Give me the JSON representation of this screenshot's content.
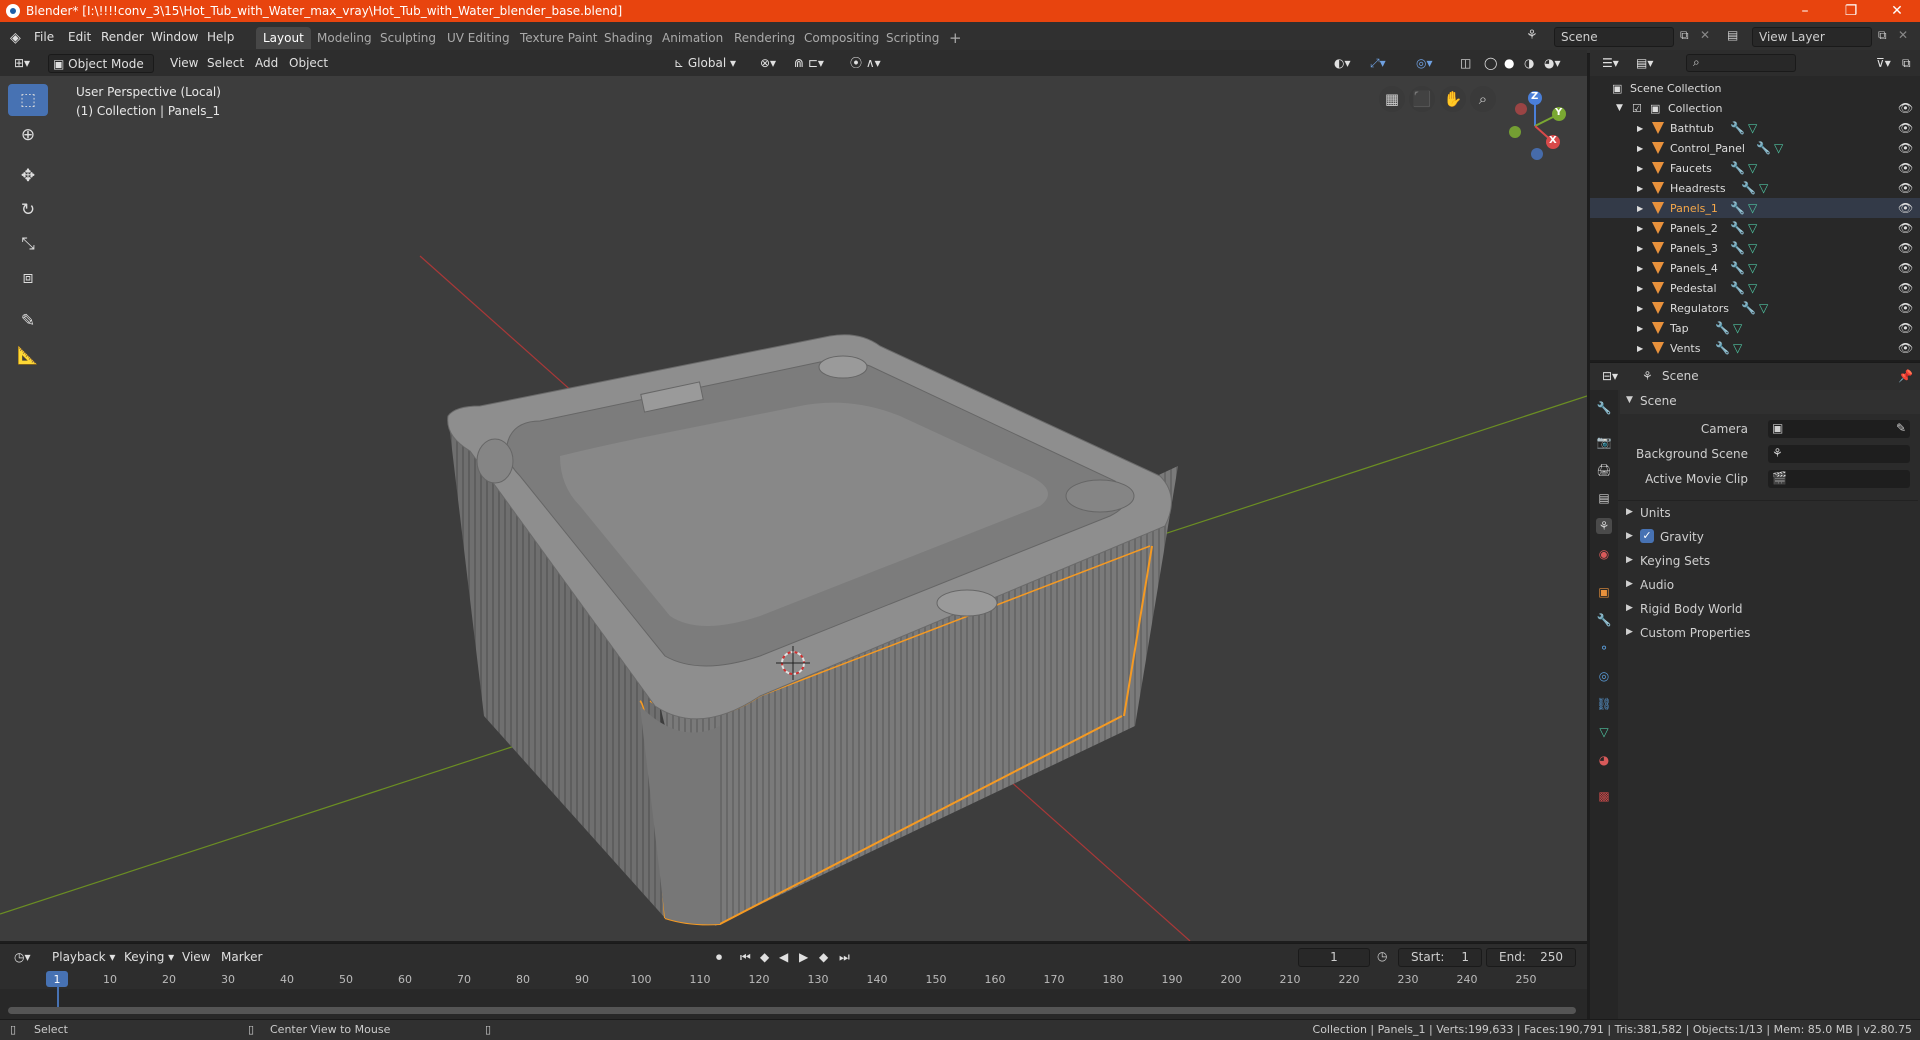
{
  "titlebar": {
    "title": "Blender* [I:\\!!!!conv_3\\15\\Hot_Tub_with_Water_max_vray\\Hot_Tub_with_Water_blender_base.blend]",
    "minimize": "–",
    "maximize": "❐",
    "close": "✕"
  },
  "menus": [
    "File",
    "Edit",
    "Render",
    "Window",
    "Help"
  ],
  "workspaces": [
    "Layout",
    "Modeling",
    "Sculpting",
    "UV Editing",
    "Texture Paint",
    "Shading",
    "Animation",
    "Rendering",
    "Compositing",
    "Scripting"
  ],
  "workspace_add": "+",
  "scene_selector": "Scene",
  "viewlayer_selector": "View Layer",
  "viewport_header": {
    "mode": "Object Mode",
    "view": "View",
    "select": "Select",
    "add": "Add",
    "object": "Object",
    "orientation": "Global"
  },
  "viewport": {
    "perspective": "User Perspective (Local)",
    "collection": "(1) Collection | Panels_1"
  },
  "gizmo": {
    "z": "Z",
    "y": "Y",
    "x": "X"
  },
  "timeline_header": {
    "playback": "Playback",
    "keying": "Keying",
    "view": "View",
    "marker": "Marker",
    "frame": "1",
    "start_label": "Start:",
    "start": "1",
    "end_label": "End:",
    "end": "250"
  },
  "timeline_ticks": [
    "1",
    "10",
    "20",
    "30",
    "40",
    "50",
    "60",
    "70",
    "80",
    "90",
    "100",
    "110",
    "120",
    "130",
    "140",
    "150",
    "160",
    "170",
    "180",
    "190",
    "200",
    "210",
    "220",
    "230",
    "240",
    "250"
  ],
  "outliner": {
    "scene_collection": "Scene Collection",
    "collection": "Collection",
    "items": [
      "Bathtub",
      "Control_Panel",
      "Faucets",
      "Headrests",
      "Panels_1",
      "Panels_2",
      "Panels_3",
      "Panels_4",
      "Pedestal",
      "Regulators",
      "Tap",
      "Vents"
    ],
    "selected": "Panels_1"
  },
  "properties": {
    "header_title": "Scene",
    "panel_title": "Scene",
    "camera_label": "Camera",
    "background_label": "Background Scene",
    "movieclip_label": "Active Movie Clip",
    "sections": [
      "Units",
      "Gravity",
      "Keying Sets",
      "Audio",
      "Rigid Body World",
      "Custom Properties"
    ]
  },
  "statusbar": {
    "select": "Select",
    "center_view": "Center View to Mouse",
    "stats": "Collection | Panels_1 | Verts:199,633 | Faces:190,791 | Tris:381,582 | Objects:1/13 | Mem: 85.0 MB | v2.80.75"
  },
  "colors": {
    "title_bar": "#e8440e",
    "accent": "#4772b3",
    "selection": "#f59a23",
    "object_icon": "#e8913c"
  }
}
